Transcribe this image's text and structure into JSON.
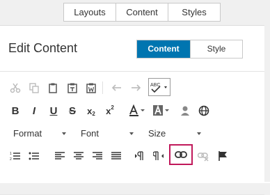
{
  "top_tabs": [
    "Layouts",
    "Content",
    "Styles"
  ],
  "panel": {
    "title": "Edit Content",
    "segments": {
      "active": "Content",
      "inactive": "Style"
    }
  },
  "toolbar": {
    "format_label": "Format",
    "font_label": "Font",
    "size_label": "Size",
    "bold": "B",
    "italic": "I",
    "underline": "U",
    "strike": "S",
    "subscript": "x",
    "subscript_sup": "2",
    "superscript": "x",
    "superscript_sup": "2",
    "spellcheck_label": "ABC",
    "highlight_color": "#c0185a"
  },
  "colors": {
    "accent": "#0075b0"
  }
}
